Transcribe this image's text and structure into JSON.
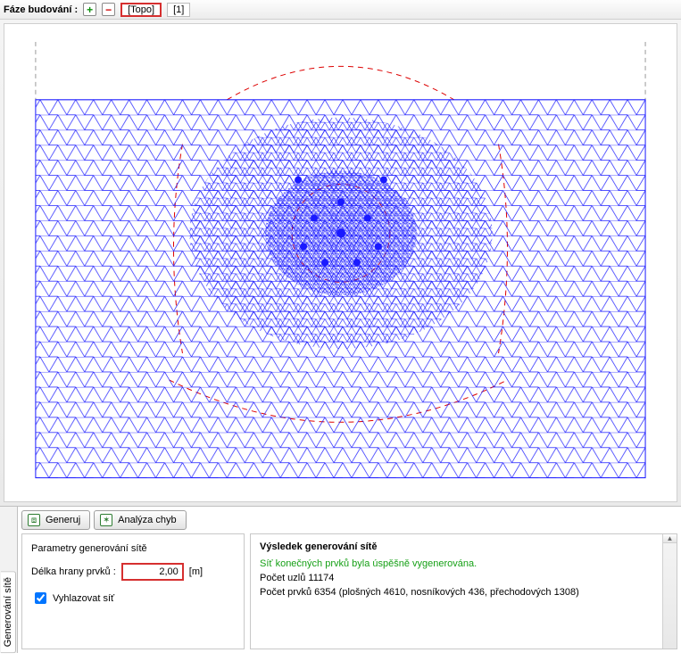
{
  "toolbar": {
    "label": "Fáze budování :",
    "add_icon": "+",
    "remove_icon": "−",
    "topo_label": "[Topo]",
    "stage1_label": "[1]"
  },
  "buttons": {
    "generate_label": "Generuj",
    "analyze_label": "Analýza chyb"
  },
  "params": {
    "section_title": "Parametry generování sítě",
    "edge_label": "Délka hrany prvků :",
    "edge_value": "2,00",
    "edge_unit": "[m]",
    "smooth_label": "Vyhlazovat síť",
    "smooth_checked": true
  },
  "result": {
    "title": "Výsledek generování sítě",
    "success_msg": "Síť konečných prvků byla úspěšně vygenerována.",
    "line_nodes": "Počet uzlů 11174",
    "line_elems": "Počet prvků 6354 (plošných 4610, nosníkových 436, přechodových 1308)"
  },
  "vtab": {
    "label": "Generování sítě"
  }
}
